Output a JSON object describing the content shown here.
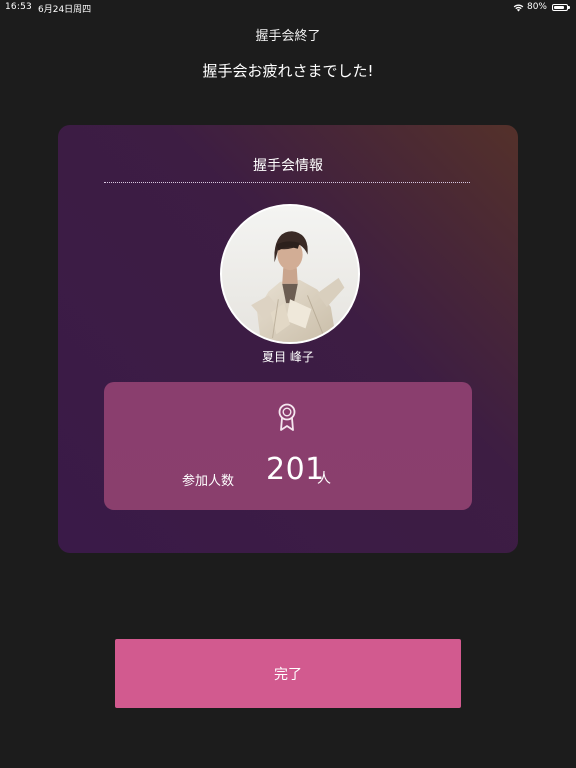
{
  "status_bar": {
    "time": "16:53",
    "date": "6月24日周四",
    "battery": "80%",
    "icons": [
      "wifi-icon",
      "battery-icon"
    ]
  },
  "header": {
    "title": "握手会終了",
    "headline": "握手会お疲れさまでした!"
  },
  "card": {
    "title": "握手会情報",
    "avatar_icon": "avatar-photo",
    "person_name": "夏目 峰子",
    "stat": {
      "icon": "award-ribbon-icon",
      "label": "参加人数",
      "value": "201",
      "unit": "人"
    }
  },
  "footer": {
    "done_label": "完了"
  },
  "colors": {
    "background": "#1c1c1c",
    "card_gradient_top_right": "#54312a",
    "card_gradient_body": "#3a1a48",
    "stat_box": "#8a3e6e",
    "button": "#d25a8f"
  }
}
